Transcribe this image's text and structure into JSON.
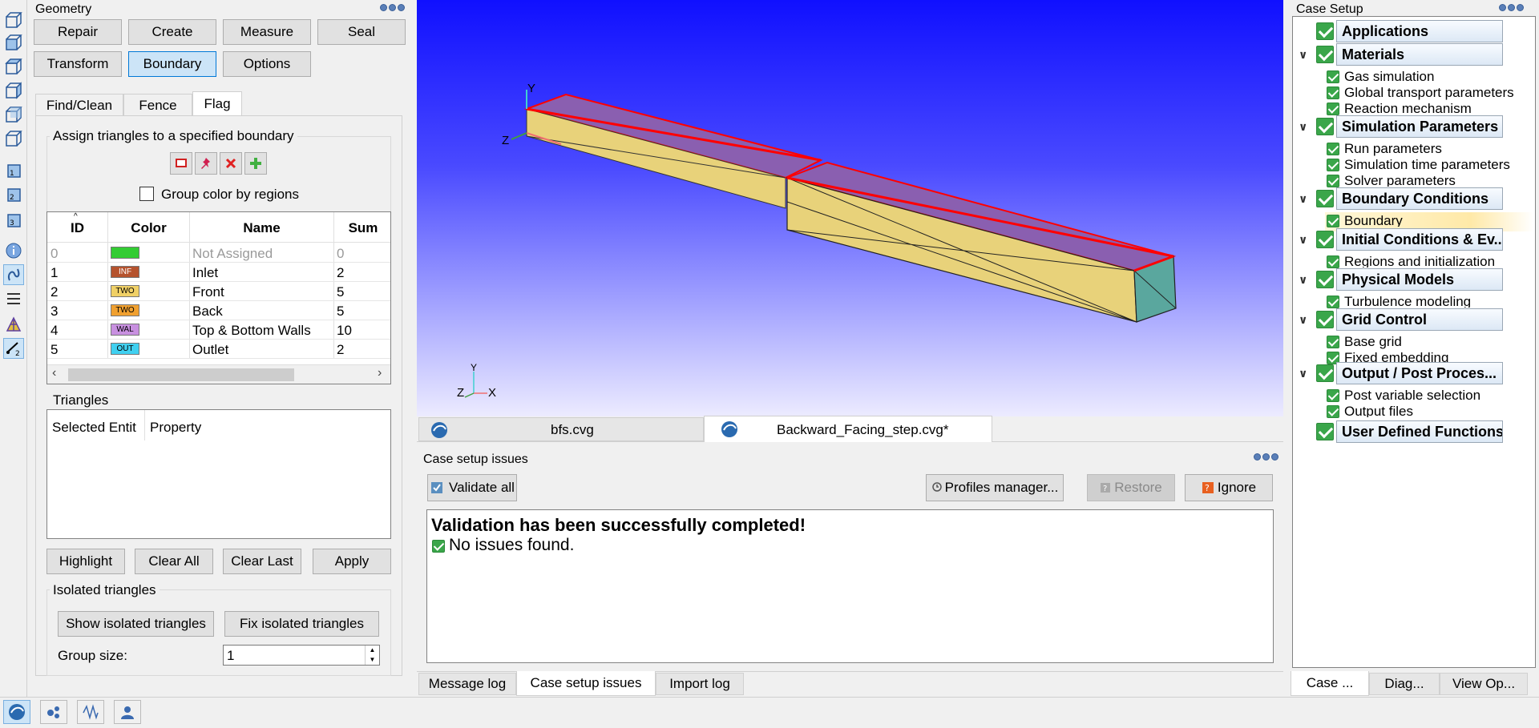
{
  "geometry": {
    "title": "Geometry",
    "buttons": {
      "repair": "Repair",
      "create": "Create",
      "measure": "Measure",
      "seal": "Seal",
      "transform": "Transform",
      "boundary": "Boundary",
      "options": "Options"
    },
    "tabs": {
      "find_clean": "Find/Clean",
      "fence": "Fence",
      "flag": "Flag"
    },
    "assign_group": "Assign triangles to a specified boundary",
    "group_color_label": "Group color by regions",
    "table": {
      "headers": {
        "id": "ID",
        "color": "Color",
        "name": "Name",
        "sum": "Sum"
      },
      "rows": [
        {
          "id": "0",
          "tag": "",
          "color": "#33cc33",
          "name": "Not Assigned",
          "sum": "0"
        },
        {
          "id": "1",
          "tag": "INF",
          "color": "#b5532e",
          "name": "Inlet",
          "sum": "2"
        },
        {
          "id": "2",
          "tag": "TWO",
          "color": "#f0d066",
          "name": "Front",
          "sum": "5"
        },
        {
          "id": "3",
          "tag": "TWO",
          "color": "#f0a030",
          "name": "Back",
          "sum": "5"
        },
        {
          "id": "4",
          "tag": "WAL",
          "color": "#c890e0",
          "name": "Top & Bottom Walls",
          "sum": "10"
        },
        {
          "id": "5",
          "tag": "OUT",
          "color": "#40d0f0",
          "name": "Outlet",
          "sum": "2"
        }
      ]
    },
    "triangles_group": "Triangles",
    "tri_headers": {
      "entity": "Selected Entit",
      "property": "Property"
    },
    "action_buttons": {
      "highlight": "Highlight",
      "clear_all": "Clear All",
      "clear_last": "Clear Last",
      "apply": "Apply"
    },
    "isolated_group": "Isolated triangles",
    "isolated_buttons": {
      "show": "Show isolated triangles",
      "fix": "Fix isolated triangles"
    },
    "group_size_label": "Group size:",
    "group_size_value": "1"
  },
  "viewport": {
    "axis_y": "Y",
    "axis_z": "Z",
    "mini_y": "Y",
    "mini_z": "Z",
    "mini_x": "X",
    "tabs": {
      "bfs": "bfs.cvg",
      "backward": "Backward_Facing_step.cvg*"
    }
  },
  "issues": {
    "title": "Case setup issues",
    "buttons": {
      "validate": "Validate all",
      "profiles": "Profiles manager...",
      "restore": "Restore",
      "ignore": "Ignore"
    },
    "message": "Validation has been successfully completed!",
    "detail": "No issues found.",
    "log_tabs": {
      "message_log": "Message log",
      "case_setup_issues": "Case setup issues",
      "import_log": "Import log"
    }
  },
  "case_setup": {
    "title": "Case Setup",
    "sections": [
      {
        "label": "Applications",
        "items": []
      },
      {
        "label": "Materials",
        "items": [
          "Gas simulation",
          "Global transport parameters",
          "Reaction mechanism"
        ]
      },
      {
        "label": "Simulation Parameters",
        "items": [
          "Run parameters",
          "Simulation time parameters",
          "Solver parameters"
        ]
      },
      {
        "label": "Boundary Conditions",
        "items": [
          "Boundary"
        ]
      },
      {
        "label": "Initial Conditions & Ev...",
        "items": [
          "Regions and initialization"
        ]
      },
      {
        "label": "Physical Models",
        "items": [
          "Turbulence modeling"
        ]
      },
      {
        "label": "Grid Control",
        "items": [
          "Base grid",
          "Fixed embedding"
        ]
      },
      {
        "label": "Output / Post Proces...",
        "items": [
          "Post variable selection",
          "Output files"
        ]
      },
      {
        "label": "User Defined Functions",
        "items": []
      }
    ],
    "bottom_tabs": {
      "case": "Case ...",
      "diag": "Diag...",
      "view": "View Op..."
    }
  },
  "colors": {
    "viewport_top": "#1010ff",
    "viewport_bottom": "#ecebff",
    "selected_face": "#8a5fb0",
    "box_face": "#e8d27a",
    "end_face": "#5aa79e",
    "edge_highlight": "#ff0000"
  }
}
